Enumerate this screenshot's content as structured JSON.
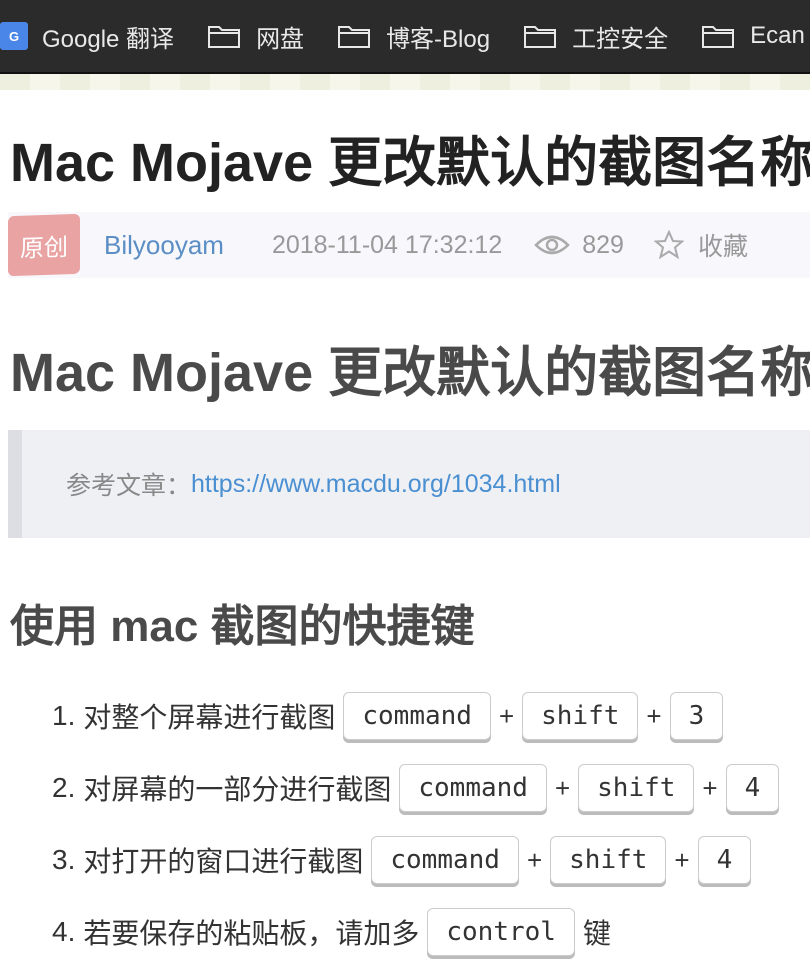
{
  "bookmarks": [
    {
      "label": "Google 翻译",
      "icon": "google-translate-icon"
    },
    {
      "label": "网盘",
      "icon": "folder-icon"
    },
    {
      "label": "博客-Blog",
      "icon": "folder-icon"
    },
    {
      "label": "工控安全",
      "icon": "folder-icon"
    },
    {
      "label": "Ecan",
      "icon": "folder-icon"
    }
  ],
  "article": {
    "title": "Mac Mojave 更改默认的截图名称",
    "badge": "原创",
    "author": "Bilyooyam",
    "date": "2018-11-04 17:32:12",
    "views": "829",
    "favorite_label": "收藏"
  },
  "content": {
    "heading": "Mac Mojave 更改默认的截图名称",
    "quote_label": "参考文章：",
    "quote_link": "https://www.macdu.org/1034.html",
    "subheading": "使用 mac 截图的快捷键",
    "steps": [
      {
        "num": "1.",
        "text": "对整个屏幕进行截图",
        "k1": "command",
        "k2": "shift",
        "k3": "3"
      },
      {
        "num": "2.",
        "text": "对屏幕的一部分进行截图",
        "k1": "command",
        "k2": "shift",
        "k3": "4"
      },
      {
        "num": "3.",
        "text": "对打开的窗口进行截图",
        "k1": "command",
        "k2": "shift",
        "k3": "4"
      },
      {
        "num": "4.",
        "text": "若要保存的粘贴板，请加多",
        "k1": "control",
        "suffix": "键"
      }
    ],
    "plus": "+"
  },
  "colors": {
    "bookmark_bar": "#2b2b2b",
    "badge": "#e9a3a3",
    "author": "#5a8ec4",
    "link": "#4a8fd1"
  }
}
